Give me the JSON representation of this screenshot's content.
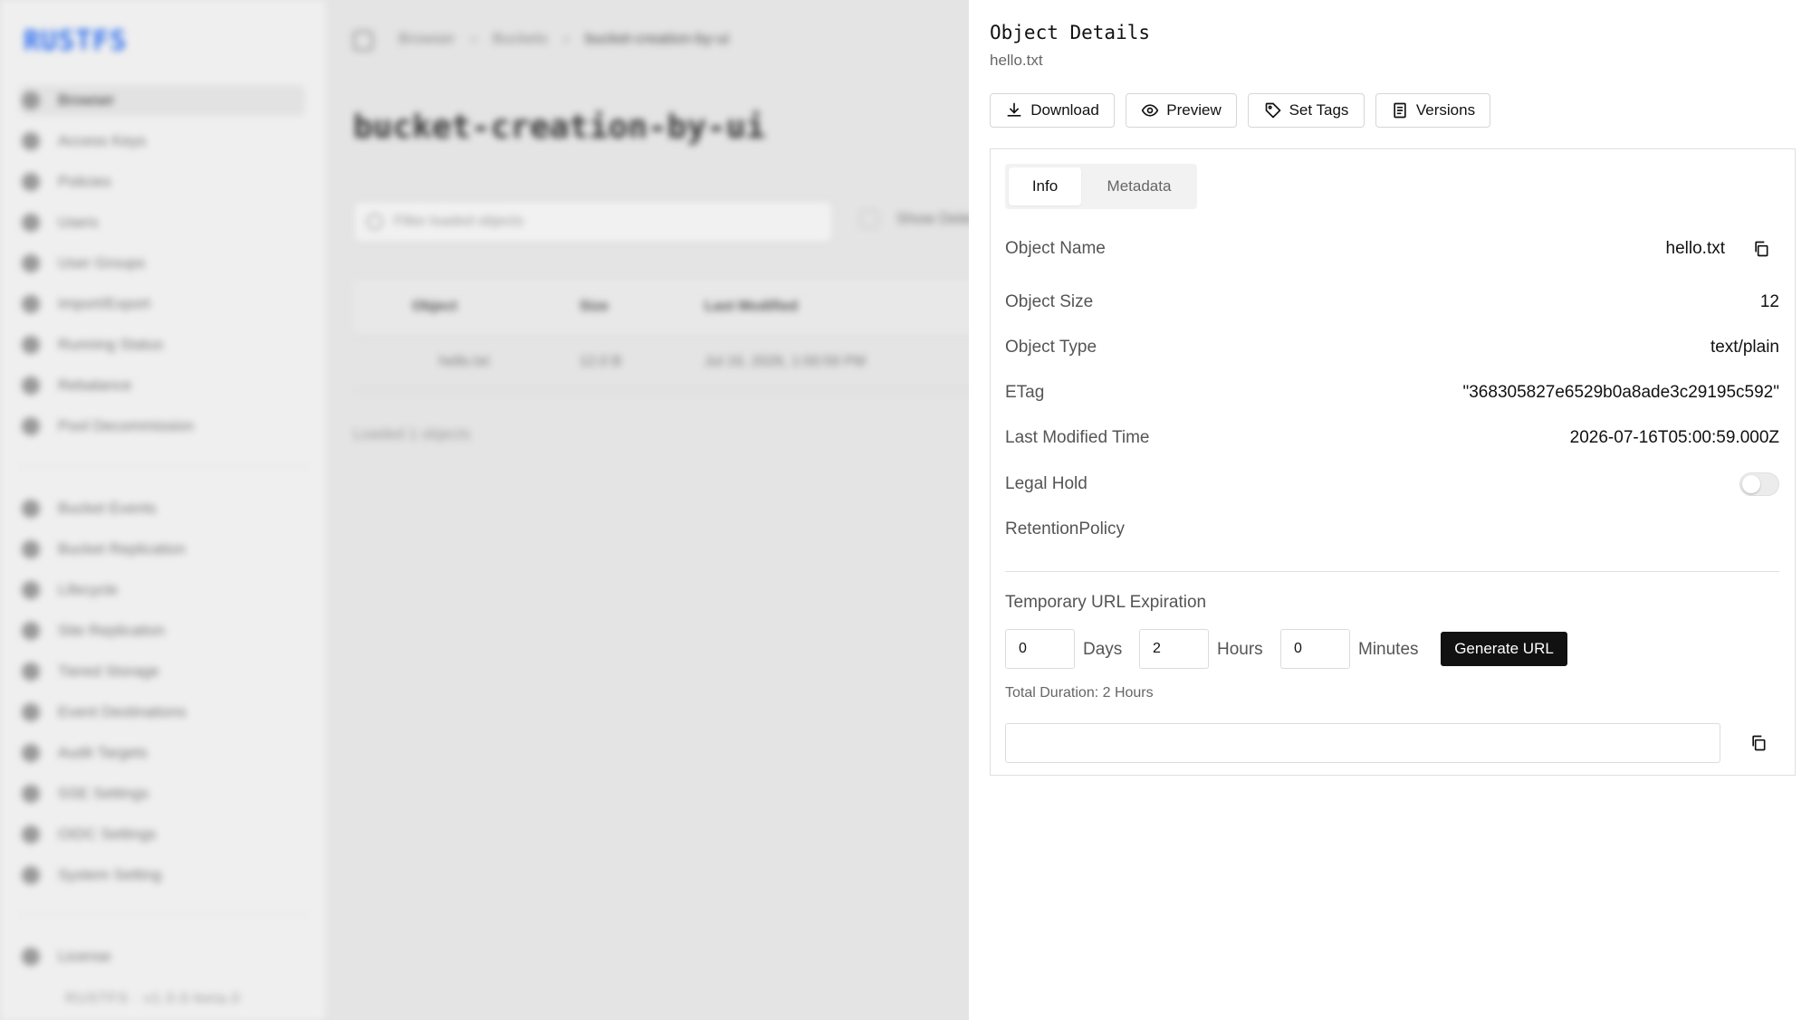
{
  "background": {
    "logo": "RUSTFS",
    "nav_items": [
      {
        "label": "Browser"
      },
      {
        "label": "Access Keys"
      },
      {
        "label": "Policies"
      },
      {
        "label": "Users"
      },
      {
        "label": "User Groups"
      },
      {
        "label": "Import/Export"
      },
      {
        "label": "Running Status"
      },
      {
        "label": "Rebalance"
      },
      {
        "label": "Pool Decommission"
      }
    ],
    "nav_items_2": [
      {
        "label": "Bucket Events"
      },
      {
        "label": "Bucket Replication"
      },
      {
        "label": "Lifecycle"
      },
      {
        "label": "Site Replication"
      },
      {
        "label": "Tiered Storage"
      },
      {
        "label": "Event Destinations"
      },
      {
        "label": "Audit Targets"
      },
      {
        "label": "SSE Settings"
      },
      {
        "label": "OIDC Settings"
      },
      {
        "label": "System Setting"
      }
    ],
    "license": "License",
    "version": "RUSTFS · v1.0.0-beta.0",
    "breadcrumb": [
      "Browser",
      "Buckets",
      "bucket-creation-by-ui"
    ],
    "title": "bucket-creation-by-ui",
    "filter_placeholder": "Filter loaded objects",
    "show_deleted": "Show Deleted",
    "table": {
      "headers": [
        "Object",
        "Size",
        "Last Modified"
      ],
      "rows": [
        [
          "hello.txt",
          "12.0 B",
          "Jul 16, 2026, 1:00:59 PM"
        ]
      ]
    },
    "loaded": "Loaded 1 objects"
  },
  "drawer": {
    "title": "Object Details",
    "subtitle": "hello.txt",
    "actions": {
      "download": "Download",
      "preview": "Preview",
      "set_tags": "Set Tags",
      "versions": "Versions"
    },
    "tabs": {
      "info": "Info",
      "metadata": "Metadata",
      "active": "Info"
    },
    "info": {
      "object_name": {
        "label": "Object Name",
        "value": "hello.txt"
      },
      "object_size": {
        "label": "Object Size",
        "value": "12"
      },
      "object_type": {
        "label": "Object Type",
        "value": "text/plain"
      },
      "etag": {
        "label": "ETag",
        "value": "\"368305827e6529b0a8ade3c29195c592\""
      },
      "last_modified": {
        "label": "Last Modified Time",
        "value": "2026-07-16T05:00:59.000Z"
      },
      "legal_hold": {
        "label": "Legal Hold",
        "enabled": false
      },
      "retention": {
        "label": "RetentionPolicy"
      }
    },
    "expiration": {
      "label": "Temporary URL Expiration",
      "days": "0",
      "days_label": "Days",
      "hours": "2",
      "hours_label": "Hours",
      "minutes": "0",
      "minutes_label": "Minutes",
      "generate_label": "Generate URL",
      "total": "Total Duration: 2 Hours",
      "url_value": ""
    }
  }
}
